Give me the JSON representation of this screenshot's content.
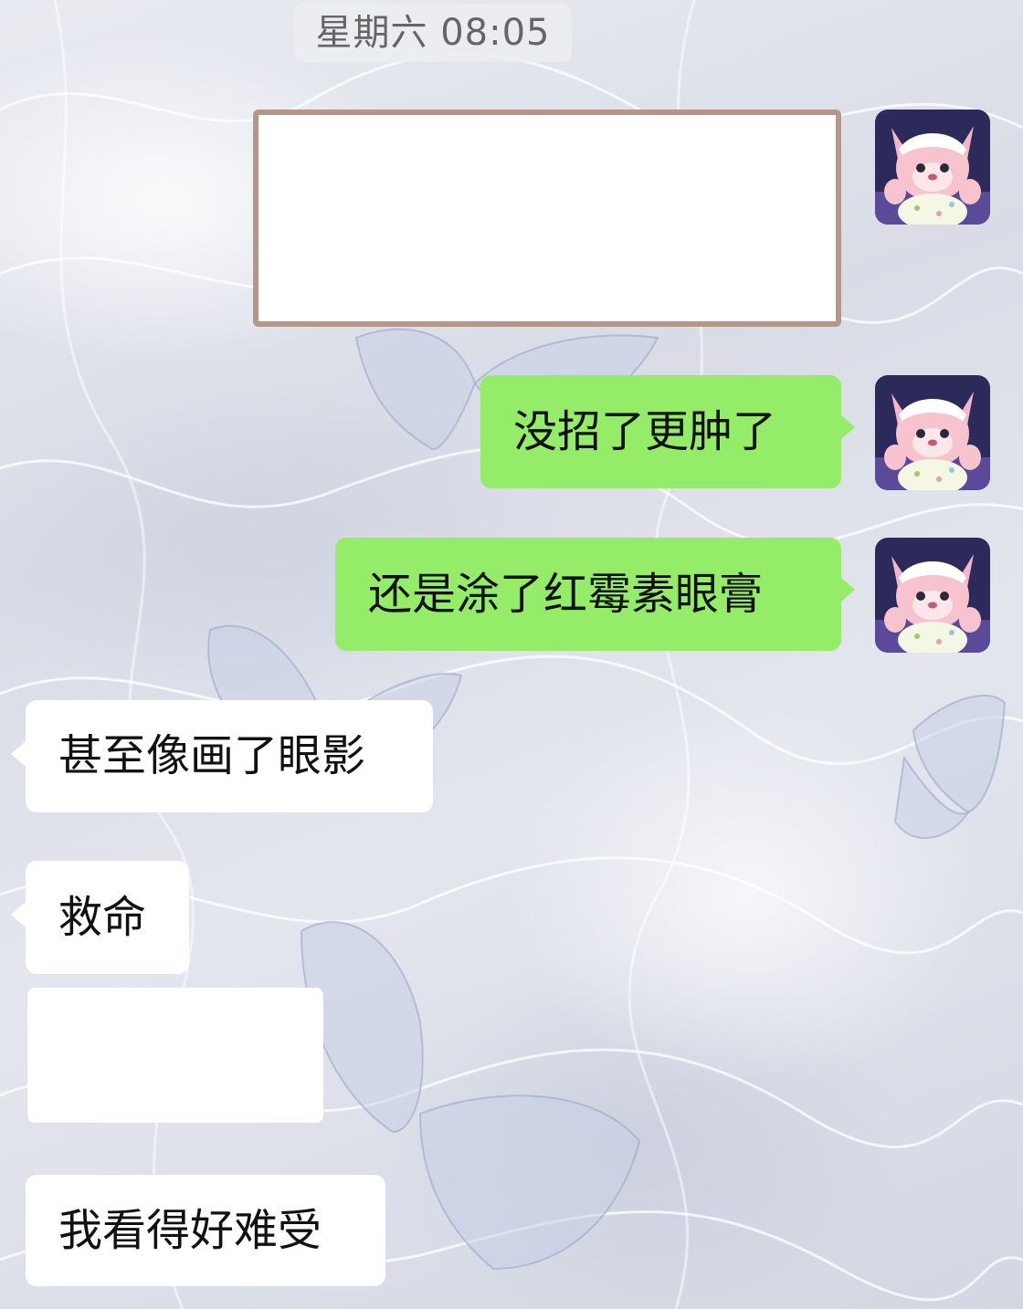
{
  "chat": {
    "timestamp": "星期六 08:05",
    "messages": [
      {
        "side": "out",
        "type": "image",
        "content": ""
      },
      {
        "side": "out",
        "type": "text",
        "content": "没招了更肿了"
      },
      {
        "side": "out",
        "type": "text",
        "content": "还是涂了红霉素眼膏"
      },
      {
        "side": "in",
        "type": "text",
        "content": "甚至像画了眼影"
      },
      {
        "side": "in",
        "type": "text",
        "content": "救命"
      },
      {
        "side": "in",
        "type": "image",
        "content": ""
      },
      {
        "side": "in",
        "type": "text",
        "content": "我看得好难受"
      }
    ]
  },
  "colors": {
    "outgoing_bubble": "#95ec69",
    "incoming_bubble": "#ffffff",
    "timestamp_text": "#666666"
  },
  "icons": {
    "self_avatar": "pink-plush-bear-avatar"
  }
}
